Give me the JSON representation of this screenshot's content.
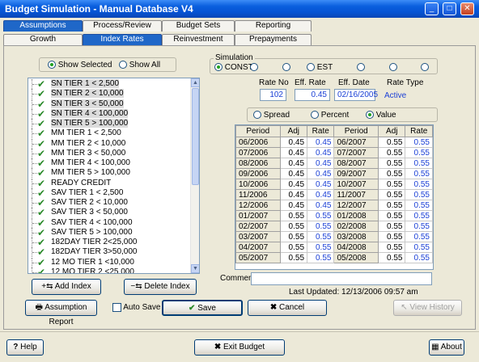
{
  "window": {
    "title": "Budget Simulation - Manual Database V4",
    "min": "_",
    "max": "□",
    "close": "✕"
  },
  "tabs_top": [
    {
      "label": "Assumptions"
    },
    {
      "label": "Process/Review"
    },
    {
      "label": "Budget Sets"
    },
    {
      "label": "Reporting"
    }
  ],
  "tabs_sub": [
    {
      "label": "Growth"
    },
    {
      "label": "Index Rates"
    },
    {
      "label": "Reinvestment Rates"
    },
    {
      "label": "Prepayments"
    }
  ],
  "list_mode": {
    "show_selected": "Show Selected",
    "show_all": "Show All"
  },
  "index_list": [
    "SN TIER 1 < 2,500",
    "SN TIER 2 < 10,000",
    "SN TIER 3 < 50,000",
    "SN TIER 4 < 100,000",
    "SN TIER 5 > 100,000",
    "MM TIER 1 < 2,500",
    "MM TIER 2 < 10,000",
    "MM TIER 3 < 50,000",
    "MM TIER 4 < 100,000",
    "MM TIER 5 > 100,000",
    "READY CREDIT",
    "SAV TIER 1 < 2,500",
    "SAV TIER 2 < 10,000",
    "SAV TIER 3 < 50,000",
    "SAV TIER 4 < 100,000",
    "SAV TIER 5 > 100,000",
    "182DAY TIER 2<25,000",
    "182DAY TIER 3>50,000",
    "12 MO TIER 1 <10,000",
    "12 MO TIER 2 <25,000"
  ],
  "simulation": {
    "label": "Simulation",
    "options": [
      "CONST",
      "",
      "",
      "EST",
      "",
      ""
    ]
  },
  "rate": {
    "rate_no_label": "Rate No",
    "rate_no": "102",
    "eff_rate_label": "Eff. Rate",
    "eff_rate": "0.45",
    "eff_date_label": "Eff. Date",
    "eff_date": "02/16/2005",
    "rate_type_label": "Rate Type",
    "rate_type": "Active"
  },
  "mode": {
    "spread": "Spread",
    "percent": "Percent",
    "value": "Value"
  },
  "grid": {
    "headers": [
      "Period",
      "Adj",
      "Rate",
      "Period",
      "Adj",
      "Rate"
    ],
    "rows": [
      [
        "06/2006",
        "0.45",
        "0.45",
        "06/2007",
        "0.55",
        "0.55"
      ],
      [
        "07/2006",
        "0.45",
        "0.45",
        "07/2007",
        "0.55",
        "0.55"
      ],
      [
        "08/2006",
        "0.45",
        "0.45",
        "08/2007",
        "0.55",
        "0.55"
      ],
      [
        "09/2006",
        "0.45",
        "0.45",
        "09/2007",
        "0.55",
        "0.55"
      ],
      [
        "10/2006",
        "0.45",
        "0.45",
        "10/2007",
        "0.55",
        "0.55"
      ],
      [
        "11/2006",
        "0.45",
        "0.45",
        "11/2007",
        "0.55",
        "0.55"
      ],
      [
        "12/2006",
        "0.45",
        "0.45",
        "12/2007",
        "0.55",
        "0.55"
      ],
      [
        "01/2007",
        "0.55",
        "0.55",
        "01/2008",
        "0.55",
        "0.55"
      ],
      [
        "02/2007",
        "0.55",
        "0.55",
        "02/2008",
        "0.55",
        "0.55"
      ],
      [
        "03/2007",
        "0.55",
        "0.55",
        "03/2008",
        "0.55",
        "0.55"
      ],
      [
        "04/2007",
        "0.55",
        "0.55",
        "04/2008",
        "0.55",
        "0.55"
      ],
      [
        "05/2007",
        "0.55",
        "0.55",
        "05/2008",
        "0.55",
        "0.55"
      ]
    ]
  },
  "comment": {
    "label": "Comment:",
    "value": ""
  },
  "last_updated": "Last Updated: 12/13/2006 09:57 am",
  "buttons": {
    "add_index": "Add Index",
    "delete_index": "Delete Index",
    "assumption_report": "Assumption Report",
    "auto_save": "Auto Save",
    "save": "Save",
    "cancel": "Cancel",
    "view_history": "View History",
    "help": "Help",
    "exit_budget": "Exit Budget",
    "about": "About"
  }
}
